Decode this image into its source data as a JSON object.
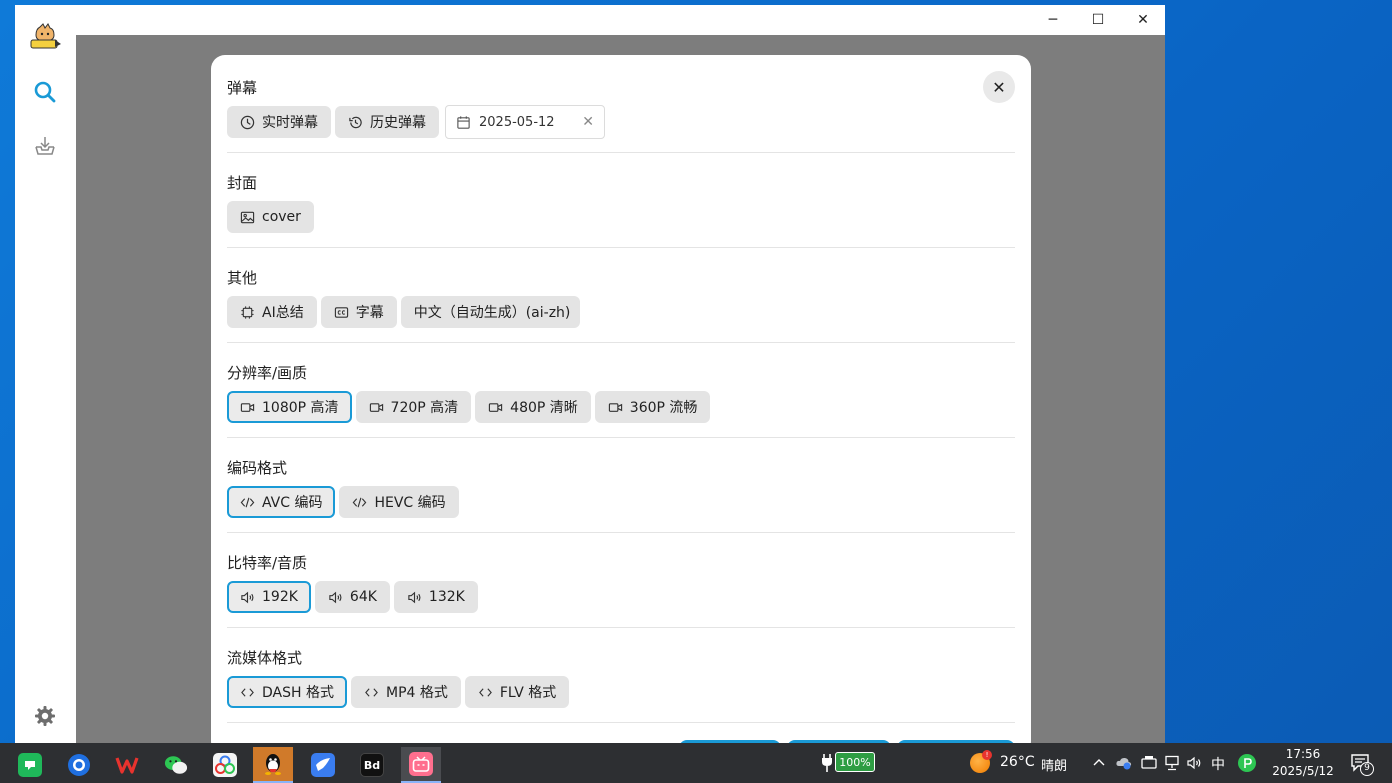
{
  "window": {
    "minimize": "─",
    "maximize": "☐",
    "close": "✕"
  },
  "sidebar": {
    "items": [
      {
        "name": "search"
      },
      {
        "name": "download"
      },
      {
        "name": "settings"
      }
    ]
  },
  "modal": {
    "close_label": "✕",
    "sections": {
      "danmaku": {
        "title": "弹幕",
        "chips": [
          "实时弹幕",
          "历史弹幕"
        ],
        "date": "2025-05-12",
        "date_clear": "✕"
      },
      "cover": {
        "title": "封面",
        "chips": [
          "cover"
        ]
      },
      "other": {
        "title": "其他",
        "chips": [
          "AI总结",
          "字幕",
          "中文（自动生成）(ai-zh)"
        ]
      },
      "resolution": {
        "title": "分辨率/画质",
        "chips": [
          "1080P 高清",
          "720P 高清",
          "480P 清晰",
          "360P 流畅"
        ],
        "selected": 0
      },
      "codec": {
        "title": "编码格式",
        "chips": [
          "AVC 编码",
          "HEVC 编码"
        ],
        "selected": 0
      },
      "bitrate": {
        "title": "比特率/音质",
        "chips": [
          "192K",
          "64K",
          "132K"
        ],
        "selected": 0
      },
      "stream": {
        "title": "流媒体格式",
        "chips": [
          "DASH 格式",
          "MP4 格式",
          "FLV 格式"
        ],
        "selected": 0
      }
    }
  },
  "taskbar": {
    "apps": [
      "bd-label"
    ],
    "bd_label": "Bd",
    "battery": "100%",
    "weather_temp": "26°C",
    "weather_desc": "晴朗",
    "ime": "中",
    "time": "17:56",
    "date": "2025/5/12",
    "notif_count": "9",
    "weather_badge": "!"
  },
  "colors": {
    "accent": "#1a9ad6",
    "chip_bg": "#e4e4e4",
    "overlay": "#7d7d7d",
    "desktop": "#0a64c4",
    "taskbar": "#2d2f32"
  }
}
